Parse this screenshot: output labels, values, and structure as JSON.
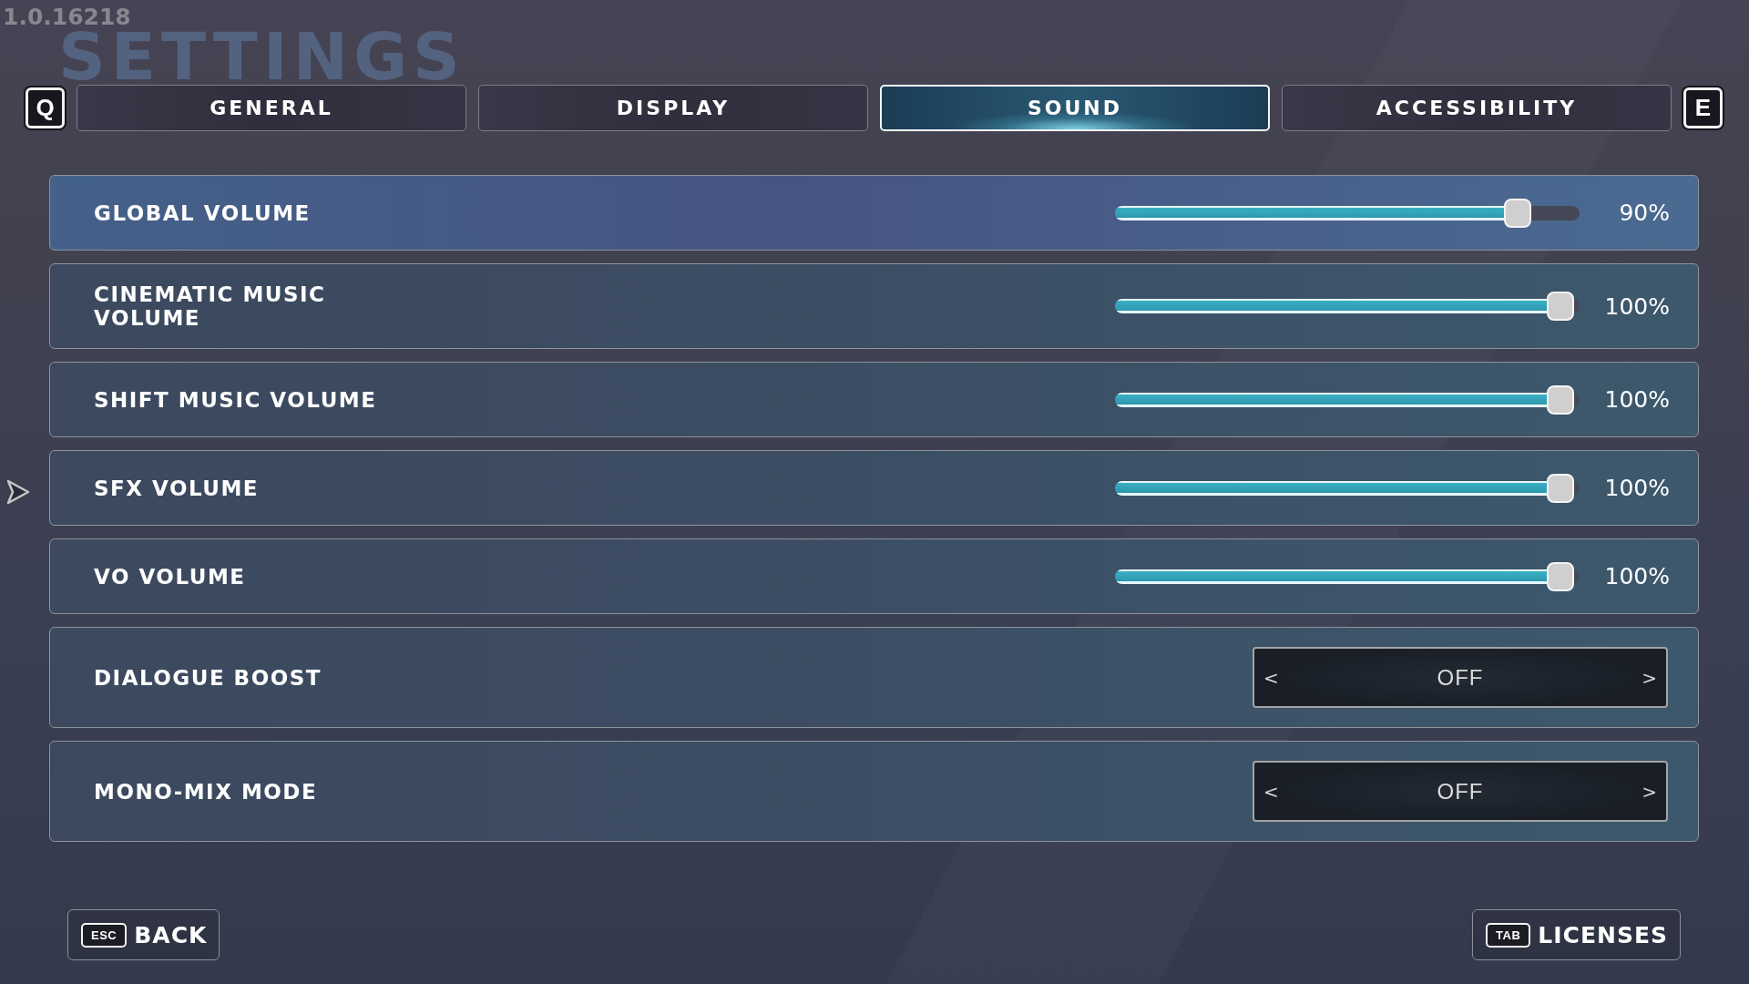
{
  "version": "1.0.16218",
  "title": "SETTINGS",
  "tabs": {
    "prev_key": "Q",
    "items": [
      {
        "label": "GENERAL",
        "selected": false
      },
      {
        "label": "DISPLAY",
        "selected": false
      },
      {
        "label": "SOUND",
        "selected": true
      },
      {
        "label": "ACCESSIBILITY",
        "selected": false
      }
    ],
    "next_key": "E"
  },
  "settings": [
    {
      "kind": "slider",
      "label": "GLOBAL VOLUME",
      "focused": true,
      "level": 0.9,
      "reading": "90%"
    },
    {
      "kind": "slider",
      "label": "CINEMATIC MUSIC VOLUME",
      "focused": false,
      "level": 1,
      "reading": "100%"
    },
    {
      "kind": "slider",
      "label": "SHIFT MUSIC VOLUME",
      "focused": false,
      "level": 1,
      "reading": "100%"
    },
    {
      "kind": "slider",
      "label": "SFX VOLUME",
      "focused": false,
      "level": 1,
      "reading": "100%"
    },
    {
      "kind": "slider",
      "label": "VO VOLUME",
      "focused": false,
      "level": 1,
      "reading": "100%"
    },
    {
      "kind": "selector",
      "label": "DIALOGUE BOOST",
      "focused": false,
      "prev": "<",
      "value": "OFF",
      "next": ">"
    },
    {
      "kind": "selector",
      "label": "MONO-MIX MODE",
      "focused": false,
      "prev": "<",
      "value": "OFF",
      "next": ">"
    }
  ],
  "footer_buttons": [
    {
      "key": "ESC",
      "label": "BACK"
    },
    {
      "key": "TAB",
      "label": "LICENSES"
    }
  ]
}
